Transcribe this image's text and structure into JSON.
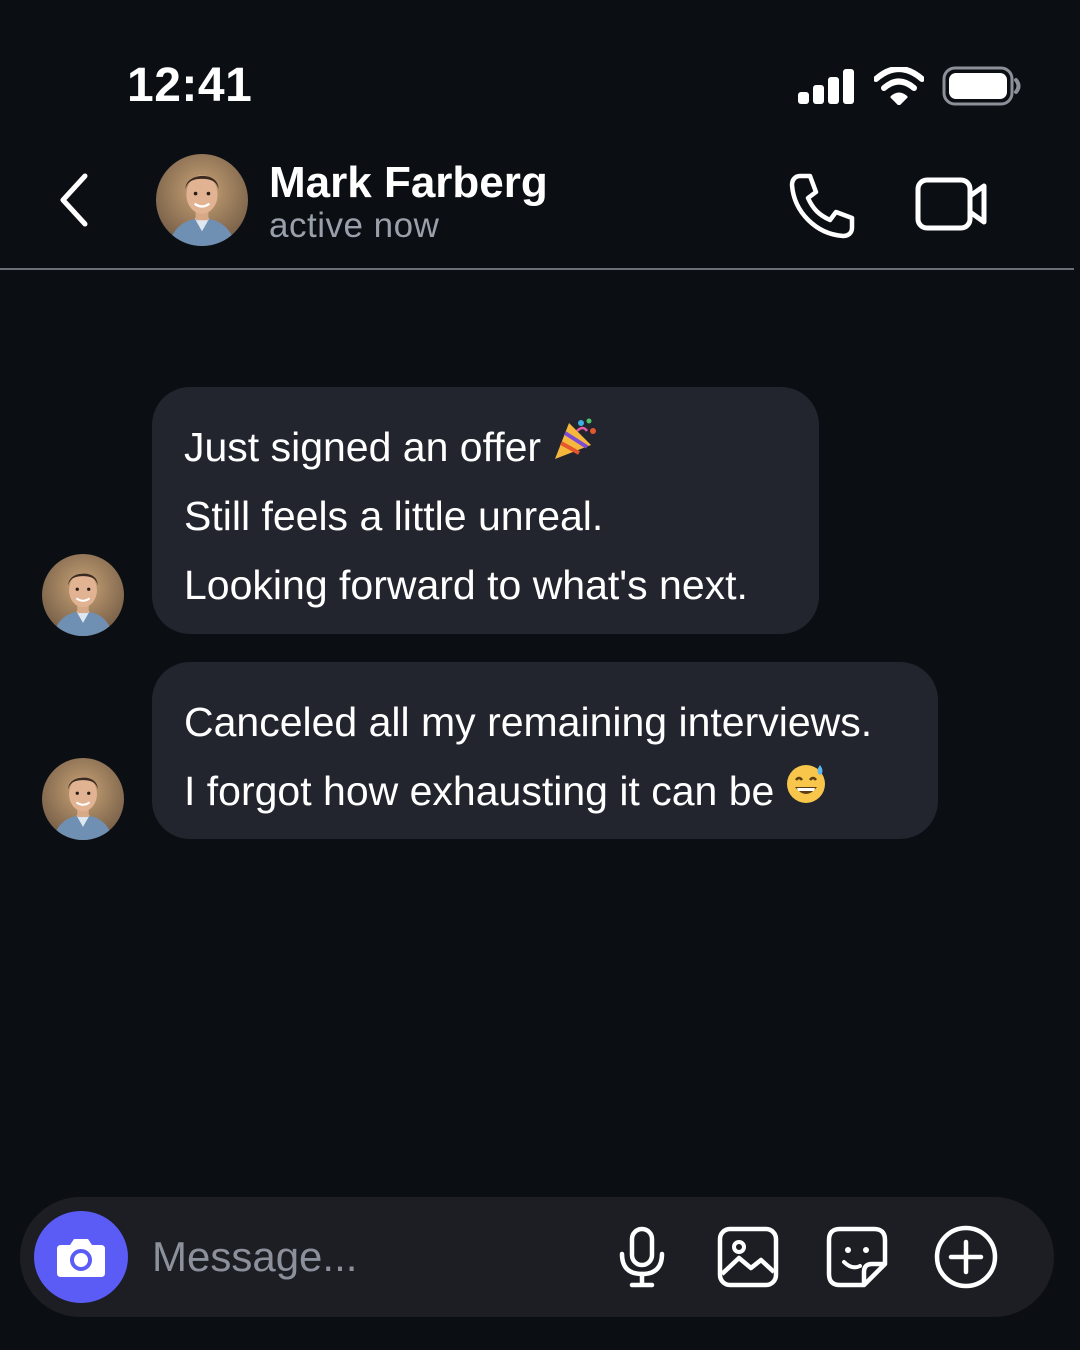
{
  "status_bar": {
    "time": "12:41",
    "icons": [
      "signal-icon",
      "wifi-icon",
      "battery-icon"
    ]
  },
  "header": {
    "back_icon": "chevron-left-icon",
    "contact_name": "Mark Farberg",
    "contact_status": "active now",
    "actions": [
      "phone-icon",
      "video-camera-icon"
    ]
  },
  "messages": [
    {
      "sender": "Mark Farberg",
      "lines": [
        "Just signed an offer",
        "Still feels a little unreal.",
        "Looking forward to what's next."
      ],
      "emoji": "party-popper-emoji"
    },
    {
      "sender": "Mark Farberg",
      "lines": [
        "Canceled all my remaining interviews.",
        "I forgot how exhausting it can be"
      ],
      "emoji": "grinning-sweat-emoji"
    }
  ],
  "composer": {
    "placeholder": "Message...",
    "tools": [
      "camera-icon",
      "microphone-icon",
      "image-icon",
      "sticker-icon",
      "plus-circle-icon"
    ]
  },
  "colors": {
    "background": "#0b0e13",
    "bubble": "#22252d",
    "composer": "#1c1e24",
    "accent": "#5b5cf6",
    "secondary_text": "#9aa0aa"
  }
}
